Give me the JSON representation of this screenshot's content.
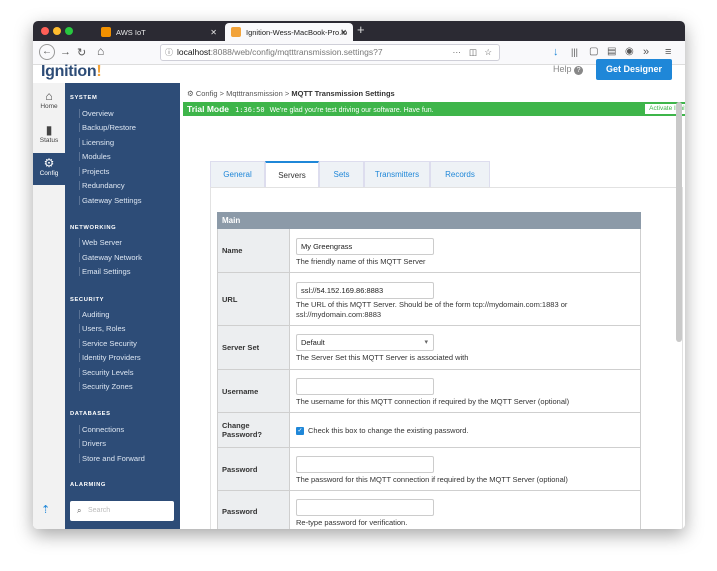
{
  "browser": {
    "tabs": [
      {
        "title": "AWS IoT",
        "close": "✕"
      },
      {
        "title": "Ignition-Wess-MacBook-Pro.lo",
        "close": "✕"
      }
    ],
    "new_tab": "+",
    "url_host": "localhost",
    "url_path": ":8088/web/config/mqtttransmission.settings?7"
  },
  "header": {
    "logo_main": "Ignition",
    "logo_accent": "!",
    "help": "Help",
    "help_icon": "?",
    "get_designer": "Get Designer"
  },
  "rail": [
    {
      "label": "Home",
      "icon": "⌂"
    },
    {
      "label": "Status",
      "icon": "▮"
    },
    {
      "label": "Config",
      "icon": "⚙"
    }
  ],
  "sidebar": {
    "sections": [
      {
        "title": "SYSTEM",
        "items": [
          "Overview",
          "Backup/Restore",
          "Licensing",
          "Modules",
          "Projects",
          "Redundancy",
          "Gateway Settings"
        ]
      },
      {
        "title": "NETWORKING",
        "items": [
          "Web Server",
          "Gateway Network",
          "Email Settings"
        ]
      },
      {
        "title": "SECURITY",
        "items": [
          "Auditing",
          "Users, Roles",
          "Service Security",
          "Identity Providers",
          "Security Levels",
          "Security Zones"
        ]
      },
      {
        "title": "DATABASES",
        "items": [
          "Connections",
          "Drivers",
          "Store and Forward"
        ]
      },
      {
        "title": "ALARMING",
        "items": []
      }
    ],
    "search_placeholder": "Search"
  },
  "breadcrumb": {
    "root": "Config",
    "mid": "Mqtttransmission",
    "current": "MQTT Transmission Settings",
    "sep": ">"
  },
  "trial": {
    "title": "Trial Mode",
    "timer": "1:36:50",
    "message": "We're glad you're test driving our software. Have fun.",
    "activate": "Activate Ignition"
  },
  "tabs": [
    "General",
    "Servers",
    "Sets",
    "Transmitters",
    "Records"
  ],
  "active_tab": "Servers",
  "form": {
    "section": "Main",
    "name_label": "Name",
    "name_value": "My Greengrass",
    "name_desc": "The friendly name of this MQTT Server",
    "url_label": "URL",
    "url_value": "ssl://54.152.169.86:8883",
    "url_desc": "The URL of this MQTT Server. Should be of the form tcp://mydomain.com:1883 or ssl://mydomain.com:8883",
    "serverset_label": "Server Set",
    "serverset_value": "Default",
    "serverset_desc": "The Server Set this MQTT Server is associated with",
    "username_label": "Username",
    "username_desc": "The username for this MQTT connection if required by the MQTT Server (optional)",
    "changepw_label": "Change Password?",
    "changepw_desc": "Check this box to change the existing password.",
    "changepw_checked": true,
    "password_label": "Password",
    "password_desc": "The password for this MQTT connection if required by the MQTT Server (optional)",
    "password2_label": "Password",
    "password2_desc": "Re-type password for verification."
  },
  "colors": {
    "sidebar": "#2d4c77",
    "accent": "#1f87d8",
    "trial": "#3eb54a",
    "section_header": "#8c9aa8"
  }
}
